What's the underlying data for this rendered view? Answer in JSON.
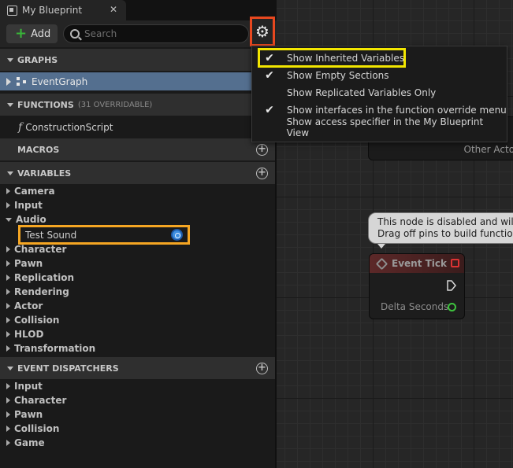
{
  "tab": {
    "title": "My Blueprint",
    "close": "✕"
  },
  "toolbar": {
    "add_label": "Add",
    "search_placeholder": "Search",
    "gear": "⚙"
  },
  "sections": {
    "graphs": "GRAPHS",
    "functions": "FUNCTIONS",
    "functions_sub": "(31 OVERRIDABLE)",
    "macros": "MACROS",
    "variables": "VARIABLES",
    "event_dispatchers": "EVENT DISPATCHERS"
  },
  "graphs": {
    "item": "EventGraph"
  },
  "functions": {
    "item": "ConstructionScript"
  },
  "variables": {
    "categories": [
      "Camera",
      "Input",
      "Audio",
      "Character",
      "Pawn",
      "Replication",
      "Rendering",
      "Actor",
      "Collision",
      "HLOD",
      "Transformation"
    ],
    "audio_child": "Test Sound"
  },
  "event_dispatchers": {
    "categories": [
      "Input",
      "Character",
      "Pawn",
      "Collision",
      "Game"
    ]
  },
  "menu": {
    "items": [
      {
        "label": "Show Inherited Variables",
        "checked": true
      },
      {
        "label": "Show Empty Sections",
        "checked": true
      },
      {
        "label": "Show Replicated Variables Only",
        "checked": false
      },
      {
        "label": "Show interfaces in the function override menu",
        "checked": true
      },
      {
        "label": "Show access specifier in the My Blueprint View",
        "checked": false
      }
    ]
  },
  "graph": {
    "top_node_pin": "Other Actor",
    "tooltip_line1": "This node is disabled and will n",
    "tooltip_line2": "Drag off pins to build functiona",
    "tick_title": "Event Tick",
    "tick_pin": "Delta Seconds"
  },
  "colors": {
    "selected_row": "#546f8f",
    "gear_highlight": "#e8481f",
    "menu_highlight": "#f2e600",
    "variable_highlight": "#f5a623",
    "add_plus": "#39b539"
  }
}
